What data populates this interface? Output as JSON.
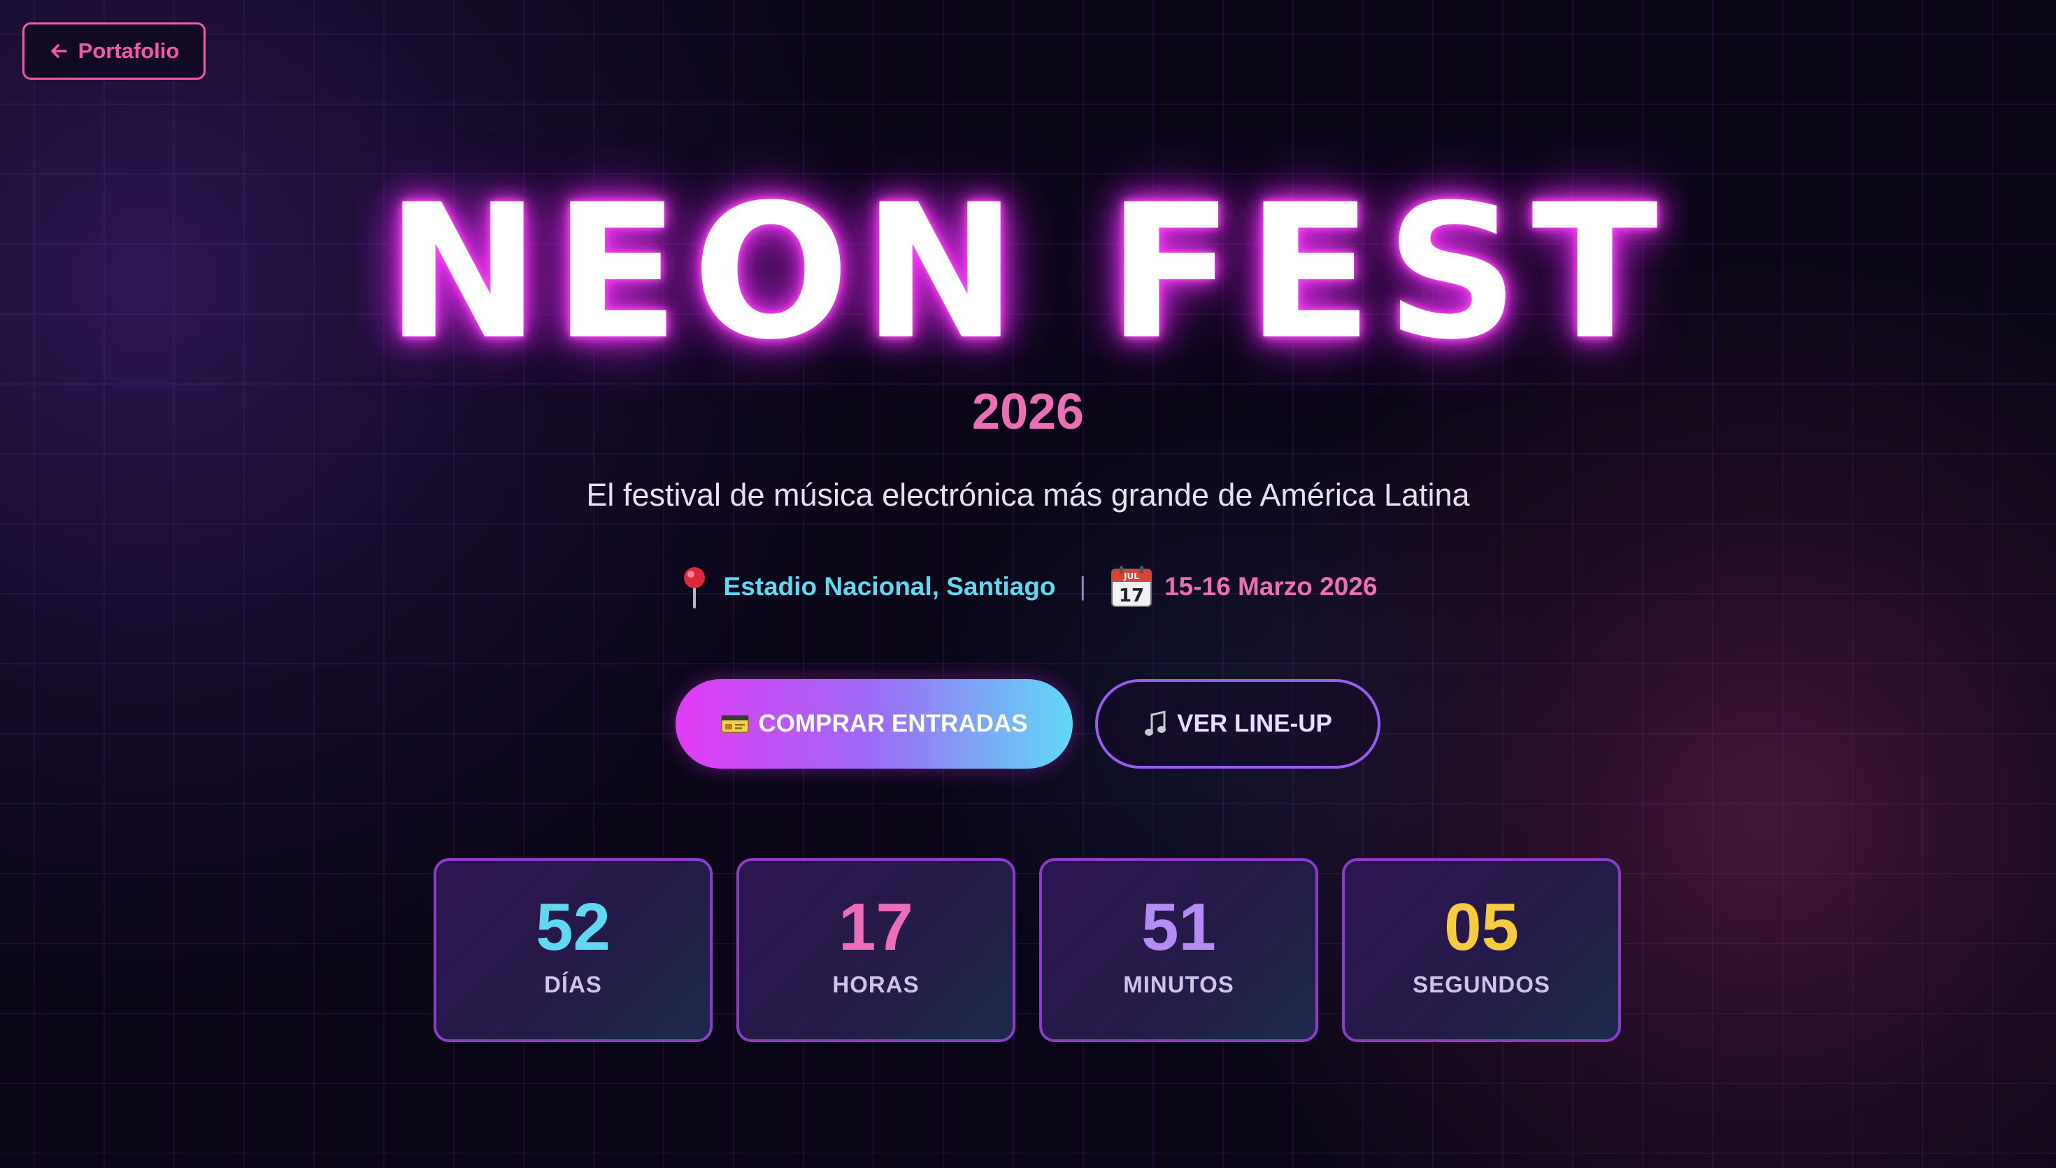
{
  "nav": {
    "back_label": "Portafolio"
  },
  "hero": {
    "title": "NEON FEST",
    "year": "2026",
    "subtitle": "El festival de música electrónica más grande de América Latina",
    "location": "Estadio Nacional, Santiago",
    "separator": "|",
    "date": "15-16 Marzo 2026",
    "calendar_icon": {
      "month": "JUL",
      "day": "17"
    }
  },
  "actions": {
    "buy_label": "COMPRAR ENTRADAS",
    "lineup_label": "VER LINE-UP"
  },
  "countdown": [
    {
      "value": "52",
      "label": "DÍAS",
      "color": "#5fd8f0"
    },
    {
      "value": "17",
      "label": "HORAS",
      "color": "#ec6fb6"
    },
    {
      "value": "51",
      "label": "MINUTOS",
      "color": "#b58cf5"
    },
    {
      "value": "05",
      "label": "SEGUNDOS",
      "color": "#f5cc40"
    }
  ],
  "colors": {
    "accent_pink": "#f05aa8",
    "accent_magenta": "#e23bf5",
    "accent_cyan": "#5fd8f0",
    "accent_purple": "#9a5bf0",
    "background": "#0a0618"
  },
  "icons": {
    "back": "arrow-left-icon",
    "location": "pin-icon",
    "date": "calendar-icon",
    "tickets": "ticket-icon",
    "lineup": "music-note-icon"
  }
}
